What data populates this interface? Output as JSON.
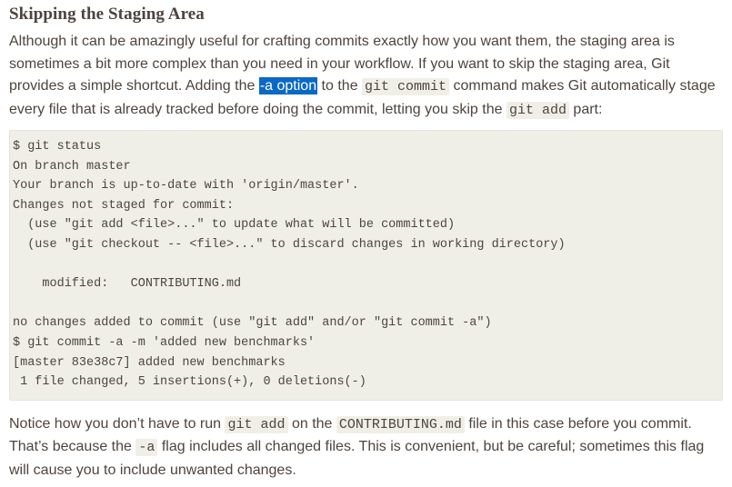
{
  "section": {
    "title": "Skipping the Staging Area"
  },
  "intro": {
    "t1": "Although it can be amazingly useful for crafting commits exactly how you want them, the staging area is sometimes a bit more complex than you need in your workflow. If you want to skip the staging area, Git provides a simple shortcut. Adding the ",
    "highlight_code": "-a",
    "highlight_text": " option",
    "t2": " to the ",
    "code1": "git commit",
    "t3": " command makes Git automatically stage every file that is already tracked before doing the commit, letting you skip the ",
    "code2": "git add",
    "t4": " part:"
  },
  "terminal": {
    "lines": [
      "$ git status",
      "On branch master",
      "Your branch is up-to-date with 'origin/master'.",
      "Changes not staged for commit:",
      "  (use \"git add <file>...\" to update what will be committed)",
      "  (use \"git checkout -- <file>...\" to discard changes in working directory)",
      "",
      "    modified:   CONTRIBUTING.md",
      "",
      "no changes added to commit (use \"git add\" and/or \"git commit -a\")",
      "$ git commit -a -m 'added new benchmarks'",
      "[master 83e38c7] added new benchmarks",
      " 1 file changed, 5 insertions(+), 0 deletions(-)"
    ]
  },
  "outro": {
    "t1": "Notice how you don’t have to run ",
    "code1": "git add",
    "t2": " on the ",
    "code2": "CONTRIBUTING.md",
    "t3": " file in this case before you commit. That’s because the ",
    "code3": "-a",
    "t4": " flag includes all changed files. This is convenient, but be careful; sometimes this flag will cause you to include unwanted changes."
  },
  "colors": {
    "text": "#4e443c",
    "code_bg": "#f0efe7",
    "selection": "#0a69c6"
  }
}
